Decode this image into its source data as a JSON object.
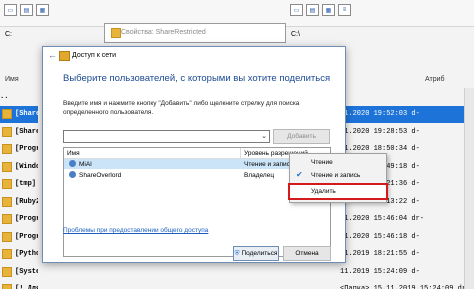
{
  "file_manager": {
    "left_drive": "C:",
    "right_drive": "C:\\",
    "left_col_header": "Имя",
    "right_col_attr": "Атриб",
    "left_items": [
      {
        "name": "..",
        "selected": false
      },
      {
        "name": "[Share",
        "selected": true
      },
      {
        "name": "[Share",
        "selected": false
      },
      {
        "name": "[Progr",
        "selected": false
      },
      {
        "name": "[Windo",
        "selected": false
      },
      {
        "name": "[tmp]",
        "selected": false
      },
      {
        "name": "[Ruby2",
        "selected": false
      },
      {
        "name": "[Progr",
        "selected": false
      },
      {
        "name": "[Progr",
        "selected": false
      },
      {
        "name": "[Pytho",
        "selected": false
      },
      {
        "name": "[Syste",
        "selected": false
      },
      {
        "name": "[! Для обмена]",
        "selected": false
      }
    ],
    "right_items": [
      {
        "date": "",
        "selected": false
      },
      {
        "date": "01.2020 19:52:03 d-",
        "selected": true
      },
      {
        "date": "01.2020 19:28:53 d-",
        "selected": false
      },
      {
        "date": "01.2020 18:50:34 d-",
        "selected": false
      },
      {
        "date": "01.2020 17:49:18 d-",
        "selected": false
      },
      {
        "date": "01.2020 16:21:36 d-",
        "selected": false
      },
      {
        "date": "01.2020 16:13:22 d-",
        "selected": false
      },
      {
        "date": "01.2020 15:46:04 dr-",
        "selected": false
      },
      {
        "date": "01.2020 15:46:18 d-",
        "selected": false
      },
      {
        "date": "11.2019 18:21:55 d-",
        "selected": false
      },
      {
        "date": "11.2019 15:24:09 d-",
        "selected": false
      },
      {
        "date": "<Папка> 15.11.2019 15:24:09 dr-",
        "selected": false
      }
    ]
  },
  "properties_window": {
    "title": "Свойства: ShareRestricted"
  },
  "share_dialog": {
    "title": "Доступ к сети",
    "heading": "Выберите пользователей, с которыми вы хотите поделиться",
    "description": "Введите имя и нажмите кнопку \"Добавить\" либо щелкните стрелку для поиска определенного пользователя.",
    "combo_value": "",
    "add_button": "Добавить",
    "columns": {
      "name": "Имя",
      "permission": "Уровень разрешений"
    },
    "users": [
      {
        "name": "MiAl",
        "permission": "Чтение и запись",
        "highlighted": true
      },
      {
        "name": "ShareOverlord",
        "permission": "Владелец",
        "highlighted": false
      }
    ],
    "help_link": "Проблемы при предоставлении общего доступа",
    "share_button": "Поделиться",
    "cancel_button": "Отмена"
  },
  "context_menu": {
    "items": [
      {
        "label": "Чтение",
        "checked": false
      },
      {
        "label": "Чтение и запись",
        "checked": true
      },
      {
        "label": "Удалить",
        "checked": false,
        "highlighted": true
      }
    ]
  },
  "colors": {
    "selection": "#1e73d8",
    "link": "#1a5fc0",
    "heading": "#1b4a93",
    "highlight_box": "#d41b1b"
  }
}
